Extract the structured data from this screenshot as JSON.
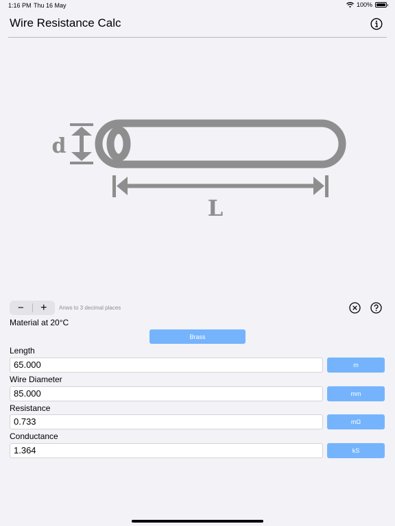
{
  "status_bar": {
    "time": "1:16 PM",
    "date": "Thu 16 May",
    "battery": "100%"
  },
  "nav": {
    "title": "Wire Resistance Calc"
  },
  "diagram": {
    "diameter_label": "d",
    "length_label": "L",
    "color": "#8e8e8e"
  },
  "controls": {
    "decrement": "−",
    "increment": "+",
    "precision_text": "Anws to 3 decimal places"
  },
  "material": {
    "label": "Material at 20°C",
    "value": "Brass"
  },
  "fields": {
    "length": {
      "label": "Length",
      "value": "65.000",
      "unit": "m"
    },
    "diameter": {
      "label": "Wire Diameter",
      "value": "85.000",
      "unit": "mm"
    },
    "resistance": {
      "label": "Resistance",
      "value": "0.733",
      "unit": "mΩ"
    },
    "conductance": {
      "label": "Conductance",
      "value": "1.364",
      "unit": "kS"
    }
  },
  "colors": {
    "accent": "#75b4fd",
    "background": "#f2f2f7",
    "diagram_gray": "#8e8e8e"
  }
}
